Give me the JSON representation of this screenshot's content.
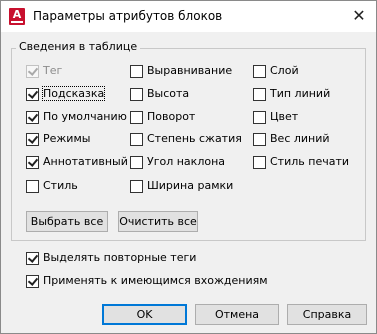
{
  "window": {
    "title": "Параметры атрибутов блоков",
    "app_icon_letter": "A",
    "close_glyph": "✕"
  },
  "group": {
    "legend": "Сведения в таблице",
    "col1": [
      {
        "label": "Тег",
        "checked": true,
        "disabled": true
      },
      {
        "label": "Подсказка",
        "checked": true,
        "disabled": false
      },
      {
        "label": "По умолчанию",
        "checked": true,
        "disabled": false
      },
      {
        "label": "Режимы",
        "checked": true,
        "disabled": false
      },
      {
        "label": "Аннотативный",
        "checked": true,
        "disabled": false
      },
      {
        "label": "Стиль",
        "checked": false,
        "disabled": false
      }
    ],
    "col2": [
      {
        "label": "Выравнивание",
        "checked": false
      },
      {
        "label": "Высота",
        "checked": false
      },
      {
        "label": "Поворот",
        "checked": false
      },
      {
        "label": "Степень сжатия",
        "checked": false
      },
      {
        "label": "Угол наклона",
        "checked": false
      },
      {
        "label": "Ширина рамки",
        "checked": false
      }
    ],
    "col3": [
      {
        "label": "Слой",
        "checked": false
      },
      {
        "label": "Тип линий",
        "checked": false
      },
      {
        "label": "Цвет",
        "checked": false
      },
      {
        "label": "Вес линий",
        "checked": false
      },
      {
        "label": "Стиль печати",
        "checked": false
      }
    ],
    "select_all_label": "Выбрать все",
    "clear_all_label": "Очистить все"
  },
  "options": {
    "highlight_duplicate_tags": {
      "label": "Выделять повторные теги",
      "checked": true
    },
    "apply_to_existing": {
      "label": "Применять к имеющимся вхождениям",
      "checked": true
    }
  },
  "footer": {
    "ok_label": "OK",
    "cancel_label": "Отмена",
    "help_label": "Справка"
  }
}
